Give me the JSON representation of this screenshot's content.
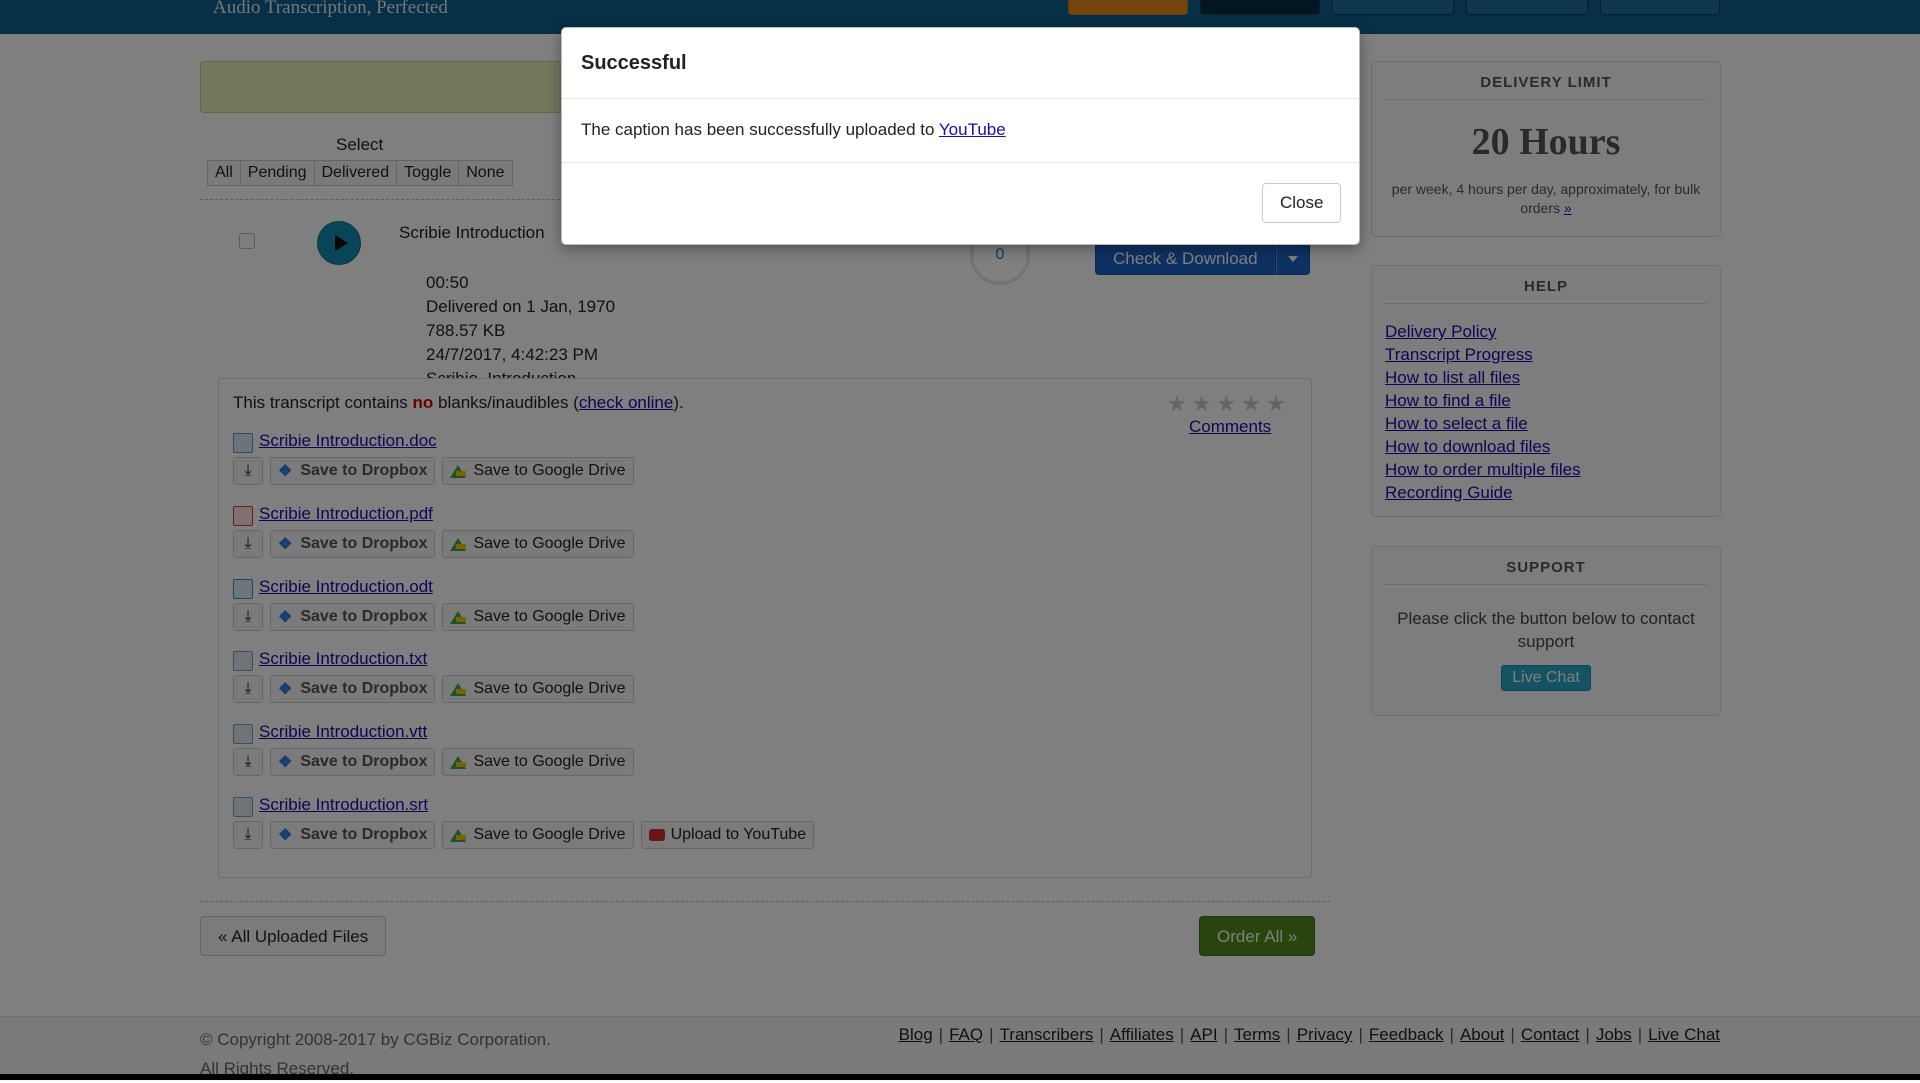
{
  "header": {
    "tagline": "Audio Transcription, Perfected"
  },
  "select": {
    "label": "Select",
    "buttons": [
      "All",
      "Pending",
      "Delivered",
      "Toggle",
      "None"
    ]
  },
  "file": {
    "title": "Scribie Introduction",
    "duration": "00:50",
    "delivered": "Delivered on 1 Jan, 1970",
    "size": "788.57 KB",
    "uploaded": "24/7/2017, 4:42:23 PM",
    "tags": "Scribie, Introduction",
    "progress_value": "0",
    "check_download_label": "Check & Download"
  },
  "transcript": {
    "note_prefix": "This transcript contains ",
    "note_no": "no",
    "note_middle": " blanks/inaudibles (",
    "note_link": "check online",
    "note_suffix": ").",
    "rating_stars": 5,
    "rating_value": 0,
    "comments_label": "Comments",
    "dropbox_label": "Save to Dropbox",
    "gdrive_label": "Save to Google Drive",
    "youtube_label": "Upload to YouTube",
    "files": [
      {
        "name": "Scribie Introduction.doc",
        "icon": "word-doc-icon"
      },
      {
        "name": "Scribie Introduction.pdf",
        "icon": "pdf-icon"
      },
      {
        "name": "Scribie Introduction.odt",
        "icon": "odt-icon"
      },
      {
        "name": "Scribie Introduction.txt",
        "icon": "text-file-icon"
      },
      {
        "name": "Scribie Introduction.vtt",
        "icon": "text-file-icon"
      },
      {
        "name": "Scribie Introduction.srt",
        "icon": "text-file-icon"
      }
    ]
  },
  "nav": {
    "all_uploaded_label": "« All Uploaded Files",
    "order_all_label": "Order All »"
  },
  "sidebar": {
    "delivery": {
      "title": "DELIVERY LIMIT",
      "amount": "20 Hours",
      "description": "per week, 4 hours per day, approximately, for bulk orders",
      "more_link": "»"
    },
    "help": {
      "title": "HELP",
      "links": [
        "Delivery Policy",
        "Transcript Progress",
        "How to list all files",
        "How to find a file",
        "How to select a file",
        "How to download files",
        "How to order multiple files",
        "Recording Guide"
      ]
    },
    "support": {
      "title": "SUPPORT",
      "text": "Please click the button below to contact support",
      "button": "Live Chat"
    }
  },
  "footer": {
    "copyright_line1": "© Copyright 2008-2017 by CGBiz Corporation.",
    "copyright_line2": "All Rights Reserved.",
    "links": [
      "Blog",
      "FAQ",
      "Transcribers",
      "Affiliates",
      "API",
      "Terms",
      "Privacy",
      "Feedback",
      "About",
      "Contact",
      "Jobs",
      "Live Chat"
    ]
  },
  "modal": {
    "title": "Successful",
    "message": "The caption has been successfully uploaded to ",
    "link": "YouTube",
    "close_label": "Close"
  },
  "colors": {
    "topbar": "#0e5e8c",
    "primary_button": "#1d63c7",
    "order_button": "#4f8a18",
    "live_chat": "#2aa6c6",
    "overlay": "rgba(0,0,0,0.5)"
  }
}
